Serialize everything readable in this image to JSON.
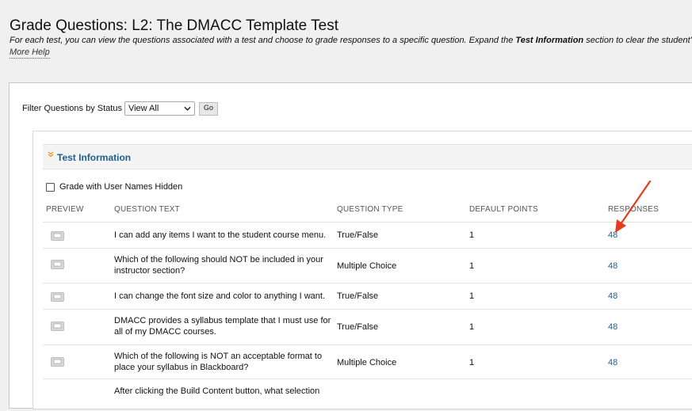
{
  "page": {
    "title": "Grade Questions: L2: The DMACC Template Test",
    "description_pre": "For each test, you can view the questions associated with a test and choose to grade responses to a specific question. Expand the ",
    "description_bold": "Test Information",
    "description_post": " section to clear the student's attempt or edi",
    "more_help": "More Help"
  },
  "filter": {
    "label": "Filter Questions by Status",
    "selected": "View All",
    "go_label": "Go"
  },
  "test_information": {
    "label": "Test Information"
  },
  "grade_hidden": {
    "label": "Grade with User Names Hidden",
    "checked": false
  },
  "table": {
    "headers": {
      "preview": "PREVIEW",
      "question_text": "QUESTION TEXT",
      "question_type": "QUESTION TYPE",
      "default_points": "DEFAULT POINTS",
      "responses": "RESPONSES"
    },
    "rows": [
      {
        "text1": "I can add any items I want to the student course menu.",
        "text2": "",
        "type": "True/False",
        "points": "1",
        "responses": "48"
      },
      {
        "text1": "Which of the following should NOT be included in your",
        "text2": "instructor section?",
        "type": "Multiple Choice",
        "points": "1",
        "responses": "48"
      },
      {
        "text1": "I can change the font size and color to anything I want.",
        "text2": "",
        "type": "True/False",
        "points": "1",
        "responses": "48"
      },
      {
        "text1": "DMACC provides a syllabus template that I must use for",
        "text2": "all of my DMACC courses.",
        "type": "True/False",
        "points": "1",
        "responses": "48"
      },
      {
        "text1": "Which of the following is NOT an acceptable format to",
        "text2": "place your syllabus in Blackboard?",
        "type": "Multiple Choice",
        "points": "1",
        "responses": "48"
      },
      {
        "text1": "After clicking the Build Content button, what selection",
        "text2": "",
        "type": "",
        "points": "",
        "responses": ""
      }
    ]
  },
  "colors": {
    "link": "#1f5f8b",
    "annotation_arrow": "#e23b1e",
    "chevron": "#e0a020"
  },
  "icons": {
    "preview": "preview-icon",
    "expand": "chevron-down-icon",
    "dropdown": "chevron-down-icon",
    "annotation": "red-arrow"
  }
}
